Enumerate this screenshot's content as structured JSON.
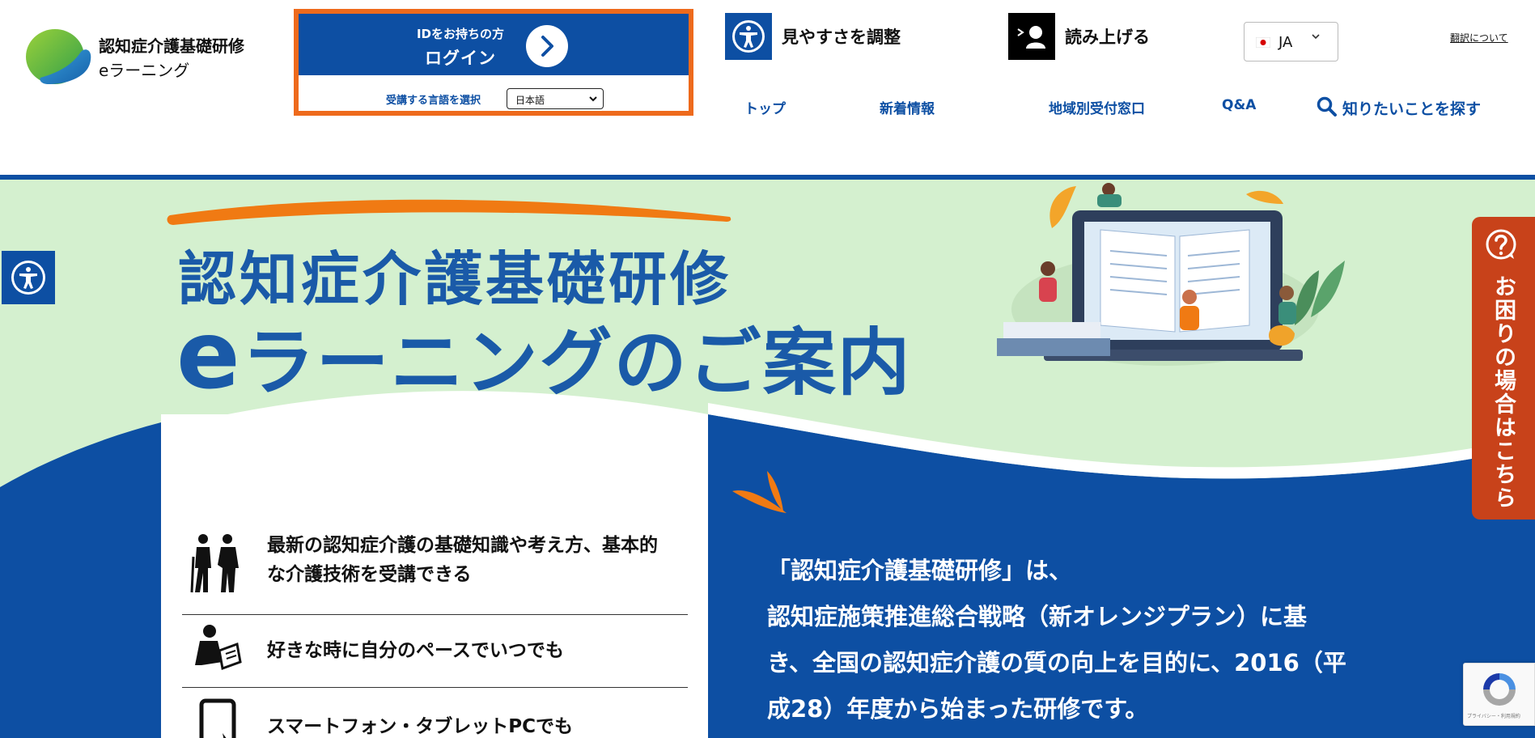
{
  "header": {
    "site_title_line1": "認知症介護基礎研修",
    "site_title_line2": "eラーニング",
    "login": {
      "sub_label": "IDをお持ちの方",
      "main_label": "ログイン",
      "language_label": "受講する言語を選択",
      "language_selected": "日本語"
    },
    "tools": {
      "accessibility_label": "見やすさを調整",
      "read_aloud_label": "読み上げる"
    },
    "language_switch": "JA",
    "translate_link": "翻訳について",
    "nav": [
      "トップ",
      "新着情報",
      "地域別受付窓口",
      "Q&A"
    ],
    "search_label": "知りたいことを探す"
  },
  "hero": {
    "title_line1": "認知症介護基礎研修",
    "title_line2_e": "e",
    "title_line2_rest": "ラーニングのご案内"
  },
  "features": [
    {
      "line1": "最新の認知症介護の基礎知識や考え方、基本的",
      "line2": "な介護技術を受講できる",
      "icon": "caregiver-elderly-icon"
    },
    {
      "line1": "好きな時に自分のペースでいつでも",
      "line2": "",
      "icon": "person-reading-icon"
    },
    {
      "line1": "スマートフォン・タブレットPCでも",
      "line2": "",
      "icon": "tablet-icon"
    }
  ],
  "intro": {
    "line1": "「認知症介護基礎研修」は、",
    "line2": "認知症施策推進総合戦略（新オレンジプラン）に基",
    "line3": "き、全国の認知症介護の質の向上を目的に、2016（平",
    "line4": "成28）年度から始まった研修です。"
  },
  "help_tab": "お困りの場合はこちら",
  "recaptcha_text": "プライバシー・利用規約",
  "colors": {
    "brand_blue": "#0d4fa3",
    "accent_orange": "#ee6a1c",
    "hero_green": "#d4f0cf",
    "help_red": "#c8421a"
  }
}
